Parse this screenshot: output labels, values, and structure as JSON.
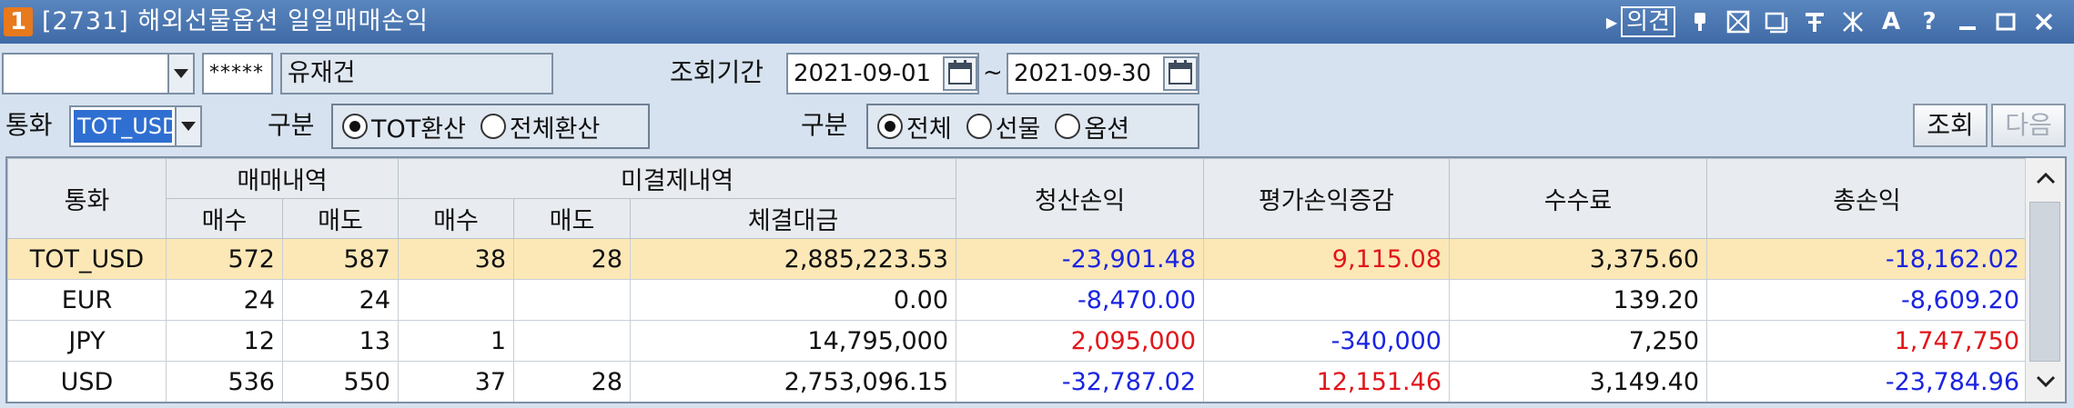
{
  "window": {
    "badge": "1",
    "title": "[2731] 해외선물옵션 일일매매손익",
    "link_label": "의견",
    "icons": [
      "pin-icon",
      "grid-icon",
      "window-icon",
      "stick-pin-icon",
      "expand-icon",
      "font-icon",
      "help-icon",
      "minimize-icon",
      "maximize-icon",
      "close-icon"
    ]
  },
  "form": {
    "account_mask": "*****",
    "account_name": "유재건",
    "period_label": "조회기간",
    "date_from": "2021-09-01",
    "date_sep": "~",
    "date_to": "2021-09-30",
    "currency_label": "통화",
    "currency_value": "TOT_USD",
    "group1_label": "구분",
    "group1_options": [
      "TOT환산",
      "전체환산"
    ],
    "group1_selected": 0,
    "group2_label": "구분",
    "group2_options": [
      "전체",
      "선물",
      "옵션"
    ],
    "group2_selected": 0,
    "query_button": "조회",
    "next_button": "다음"
  },
  "table": {
    "headers": {
      "currency": "통화",
      "trade": "매매내역",
      "open": "미결제내역",
      "buy": "매수",
      "sell": "매도",
      "open_buy": "매수",
      "open_sell": "매도",
      "contract_amount": "체결대금",
      "realized_pl": "청산손익",
      "eval_change": "평가손익증감",
      "commission": "수수료",
      "total_pl": "총손익"
    },
    "rows": [
      {
        "currency": "TOT_USD",
        "buy": "572",
        "sell": "587",
        "open_buy": "38",
        "open_sell": "28",
        "contract_amount": "2,885,223.53",
        "realized_pl": "-23,901.48",
        "eval_change": "9,115.08",
        "commission": "3,375.60",
        "total_pl": "-18,162.02"
      },
      {
        "currency": "EUR",
        "buy": "24",
        "sell": "24",
        "open_buy": "",
        "open_sell": "",
        "contract_amount": "0.00",
        "realized_pl": "-8,470.00",
        "eval_change": "",
        "commission": "139.20",
        "total_pl": "-8,609.20"
      },
      {
        "currency": "JPY",
        "buy": "12",
        "sell": "13",
        "open_buy": "1",
        "open_sell": "",
        "contract_amount": "14,795,000",
        "realized_pl": "2,095,000",
        "eval_change": "-340,000",
        "commission": "7,250",
        "total_pl": "1,747,750"
      },
      {
        "currency": "USD",
        "buy": "536",
        "sell": "550",
        "open_buy": "37",
        "open_sell": "28",
        "contract_amount": "2,753,096.15",
        "realized_pl": "-32,787.02",
        "eval_change": "12,151.46",
        "commission": "3,149.40",
        "total_pl": "-23,784.96"
      }
    ]
  },
  "colors": {
    "negative": "#1a24e0",
    "positive": "#e0161b",
    "highlight_row": "#fce8b6",
    "titlebar": "#4a76b2"
  }
}
